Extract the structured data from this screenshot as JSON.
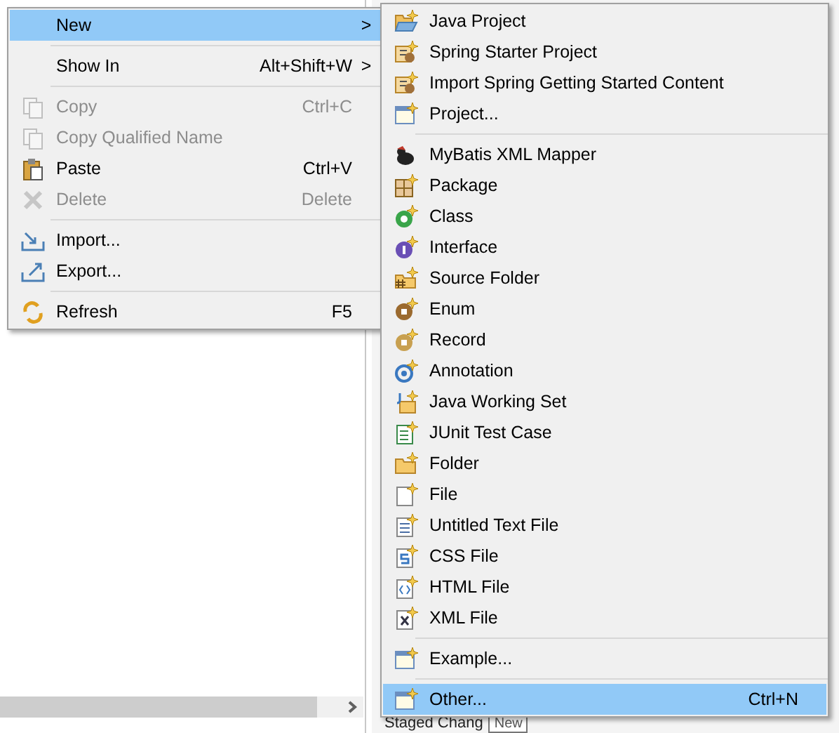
{
  "context_menu": {
    "items": [
      {
        "kind": "item",
        "label": "New",
        "arrow": ">",
        "selected": true,
        "disabled": false
      },
      {
        "kind": "separator"
      },
      {
        "kind": "item",
        "label": "Show In",
        "shortcut": "Alt+Shift+W",
        "arrow": ">",
        "selected": false,
        "disabled": false
      },
      {
        "kind": "separator"
      },
      {
        "kind": "item",
        "label": "Copy",
        "shortcut": "Ctrl+C",
        "selected": false,
        "disabled": true
      },
      {
        "kind": "item",
        "label": "Copy Qualified Name",
        "selected": false,
        "disabled": true
      },
      {
        "kind": "item",
        "label": "Paste",
        "shortcut": "Ctrl+V",
        "selected": false,
        "disabled": false
      },
      {
        "kind": "item",
        "label": "Delete",
        "shortcut": "Delete",
        "selected": false,
        "disabled": true
      },
      {
        "kind": "separator"
      },
      {
        "kind": "item",
        "label": "Import...",
        "selected": false,
        "disabled": false
      },
      {
        "kind": "item",
        "label": "Export...",
        "selected": false,
        "disabled": false
      },
      {
        "kind": "separator"
      },
      {
        "kind": "item",
        "label": "Refresh",
        "shortcut": "F5",
        "selected": false,
        "disabled": false
      }
    ]
  },
  "new_submenu": {
    "items": [
      {
        "kind": "item",
        "label": "Java Project",
        "selected": false
      },
      {
        "kind": "item",
        "label": "Spring Starter Project",
        "selected": false
      },
      {
        "kind": "item",
        "label": "Import Spring Getting Started Content",
        "selected": false
      },
      {
        "kind": "item",
        "label": "Project...",
        "selected": false
      },
      {
        "kind": "separator"
      },
      {
        "kind": "item",
        "label": "MyBatis XML Mapper",
        "selected": false
      },
      {
        "kind": "item",
        "label": "Package",
        "selected": false
      },
      {
        "kind": "item",
        "label": "Class",
        "selected": false
      },
      {
        "kind": "item",
        "label": "Interface",
        "selected": false
      },
      {
        "kind": "item",
        "label": "Source Folder",
        "selected": false
      },
      {
        "kind": "item",
        "label": "Enum",
        "selected": false
      },
      {
        "kind": "item",
        "label": "Record",
        "selected": false
      },
      {
        "kind": "item",
        "label": "Annotation",
        "selected": false
      },
      {
        "kind": "item",
        "label": "Java Working Set",
        "selected": false
      },
      {
        "kind": "item",
        "label": "JUnit Test Case",
        "selected": false
      },
      {
        "kind": "item",
        "label": "Folder",
        "selected": false
      },
      {
        "kind": "item",
        "label": "File",
        "selected": false
      },
      {
        "kind": "item",
        "label": "Untitled Text File",
        "selected": false
      },
      {
        "kind": "item",
        "label": "CSS File",
        "selected": false
      },
      {
        "kind": "item",
        "label": "HTML File",
        "selected": false
      },
      {
        "kind": "item",
        "label": "XML File",
        "selected": false
      },
      {
        "kind": "separator"
      },
      {
        "kind": "item",
        "label": "Example...",
        "selected": false
      },
      {
        "kind": "separator"
      },
      {
        "kind": "item",
        "label": "Other...",
        "shortcut": "Ctrl+N",
        "selected": true
      }
    ]
  },
  "background": {
    "panel_title": "Staged Chang",
    "tooltip": "New"
  }
}
